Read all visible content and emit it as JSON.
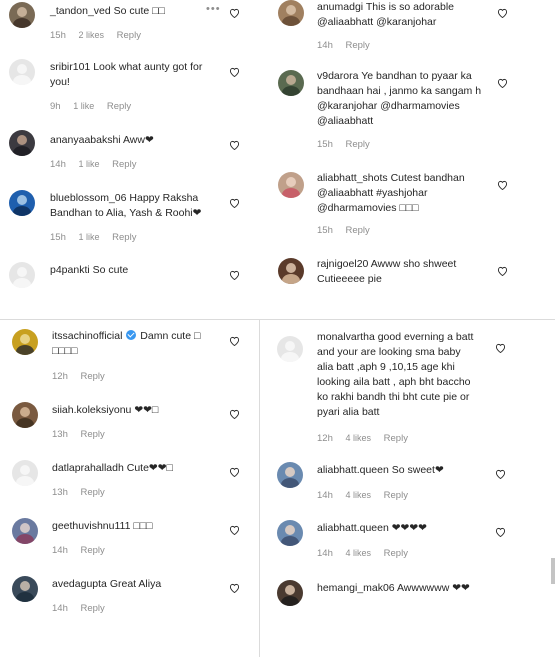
{
  "top_left": {
    "comments": [
      {
        "user": "_tandon_ved",
        "text": "So cute □□",
        "time": "15h",
        "likes": "2 likes",
        "reply": "Reply",
        "more": "•••",
        "avatar_color": "#7a6a55"
      },
      {
        "user": "sribir101",
        "text": "Look what aunty got for you!",
        "time": "9h",
        "likes": "1 like",
        "reply": "Reply",
        "avatar_color": "#e6e6e6"
      },
      {
        "user": "ananyaabakshi",
        "text": "Aww❤",
        "time": "14h",
        "likes": "1 like",
        "reply": "Reply",
        "avatar_color": "#3c3a40"
      },
      {
        "user": "blueblossom_06",
        "text": "Happy Raksha Bandhan to Alia, Yash & Roohi❤",
        "time": "15h",
        "likes": "1 like",
        "reply": "Reply",
        "avatar_color": "#1f5fae"
      },
      {
        "user": "p4pankti",
        "text": "So cute",
        "avatar_color": "#e6e6e6"
      }
    ]
  },
  "top_right": {
    "comments": [
      {
        "user": "anumadgi",
        "text": "This is so adorable @aliaabhatt @karanjohar",
        "time": "14h",
        "reply": "Reply",
        "avatar_color": "#a08060"
      },
      {
        "user": "v9darora",
        "text": "Ye bandhan to pyaar ka bandhaan hai , janmo ka sangam h @karanjohar @dharmamovies @aliaabhatt",
        "time": "15h",
        "reply": "Reply",
        "avatar_color": "#5a6a50"
      },
      {
        "user": "aliabhatt_shots",
        "text": "Cutest bandhan @aliaabhatt #yashjohar @dharmamovies □□□",
        "time": "15h",
        "reply": "Reply",
        "avatar_color": "#c0a08a"
      },
      {
        "user": "rajnigoel20",
        "text": "Awww sho shweet Cutieeeee pie",
        "avatar_color": "#5a3a2a"
      }
    ]
  },
  "bottom_left": {
    "comments": [
      {
        "user": "itssachinofficial",
        "verified": true,
        "text": "Damn cute □ □□□□",
        "time": "12h",
        "reply": "Reply",
        "avatar_color": "#c8a020"
      },
      {
        "user": "siiah.koleksiyonu",
        "text": "❤❤□",
        "time": "13h",
        "reply": "Reply",
        "avatar_color": "#7a5a40"
      },
      {
        "user": "datlaprahalladh",
        "text": "Cute❤❤□",
        "time": "13h",
        "reply": "Reply",
        "avatar_color": "#e6e6e6"
      },
      {
        "user": "geethuvishnu111",
        "text": "□□□",
        "time": "14h",
        "reply": "Reply",
        "avatar_color": "#6a7aa0"
      },
      {
        "user": "avedagupta",
        "text": "Great Aliya",
        "time": "14h",
        "reply": "Reply",
        "avatar_color": "#3a4a5a"
      }
    ]
  },
  "bottom_right": {
    "comments": [
      {
        "user": "monalvartha",
        "text": "good everning a batt and your are looking sma baby alia batt ,aph 9 ,10,15 age khi looking aila batt , aph bht baccho ko rakhi bandh thi bht cute pie or pyari alia batt",
        "time": "12h",
        "likes": "4 likes",
        "reply": "Reply",
        "avatar_color": "#e6e6e6"
      },
      {
        "user": "aliabhatt.queen",
        "text": "So sweet❤",
        "time": "14h",
        "likes": "4 likes",
        "reply": "Reply",
        "avatar_color": "#6a8ab0"
      },
      {
        "user": "aliabhatt.queen",
        "text": "❤❤❤❤",
        "time": "14h",
        "likes": "4 likes",
        "reply": "Reply",
        "avatar_color": "#6a8ab0"
      },
      {
        "user": "hemangi_mak06",
        "text": "Awwwwww ❤❤",
        "avatar_color": "#4a3a30"
      }
    ]
  }
}
